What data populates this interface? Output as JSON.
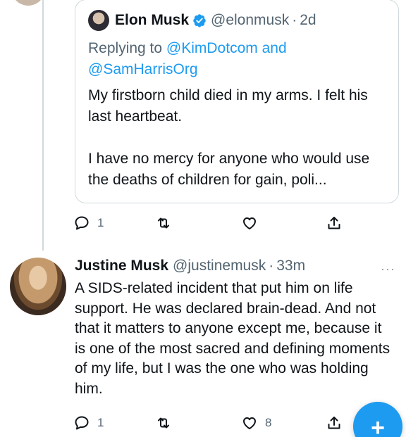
{
  "quoted_tweet": {
    "author_name": "Elon Musk",
    "handle": "@elonmusk",
    "separator": "·",
    "time": "2d",
    "replying_prefix": "Replying to",
    "replying_mention_1": "@KimDotcom",
    "replying_and": "and",
    "replying_mention_2": "@SamHarrisOrg",
    "paragraphs": [
      "My firstborn child died in my arms. I felt his last heartbeat.",
      "I have no mercy for anyone who would use the deaths of children for gain, poli..."
    ],
    "actions": {
      "reply_count": "1",
      "retweet_count": "",
      "like_count": ""
    }
  },
  "reply_tweet": {
    "author_name": "Justine Musk",
    "handle": "@justinemusk",
    "separator": "·",
    "time": "33m",
    "text": "A SIDS-related incident that put him on life support. He was declared brain-dead. And not that it matters to anyone except me, because it is one of the most sacred and defining moments of my life, but I was the one who was holding him.",
    "actions": {
      "reply_count": "1",
      "retweet_count": "",
      "like_count": "8"
    }
  },
  "more_icon": "···",
  "fab": {
    "label": "+"
  },
  "colors": {
    "accent": "#1d9bf0",
    "secondary_text": "#536471",
    "border": "#cfd9de"
  },
  "icons": [
    "verified-badge-icon",
    "reply-icon",
    "retweet-icon",
    "like-icon",
    "share-icon",
    "more-icon",
    "compose-plus-icon"
  ]
}
